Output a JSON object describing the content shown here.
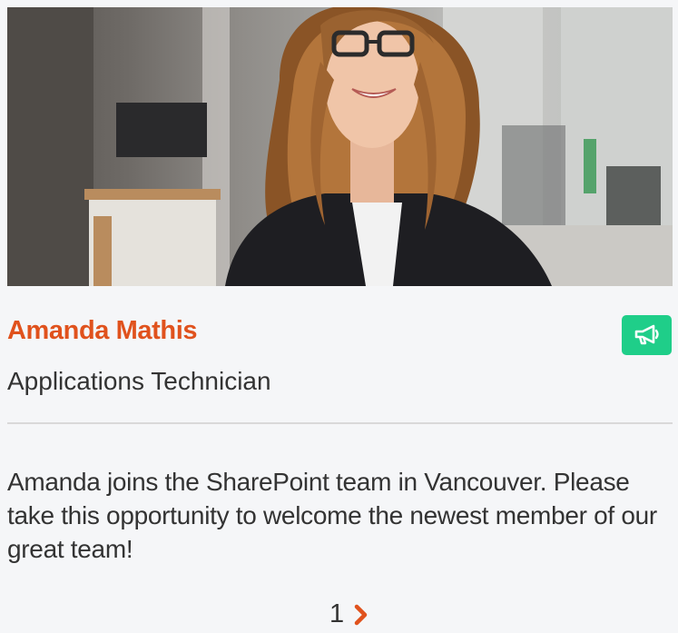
{
  "profile": {
    "name": "Amanda Mathis",
    "title": "Applications Technician",
    "photo_alt": "Amanda Mathis"
  },
  "announcement": {
    "message": "Amanda joins the SharePoint team in Vancouver. Please take this opportunity to welcome the newest member of our great team!",
    "icon": "megaphone-icon"
  },
  "pager": {
    "current": "1",
    "next_icon": "chevron-right-icon"
  },
  "colors": {
    "name": "#e0521d",
    "announce_button": "#1fce89",
    "text": "#333333",
    "background": "#f5f6f8"
  }
}
